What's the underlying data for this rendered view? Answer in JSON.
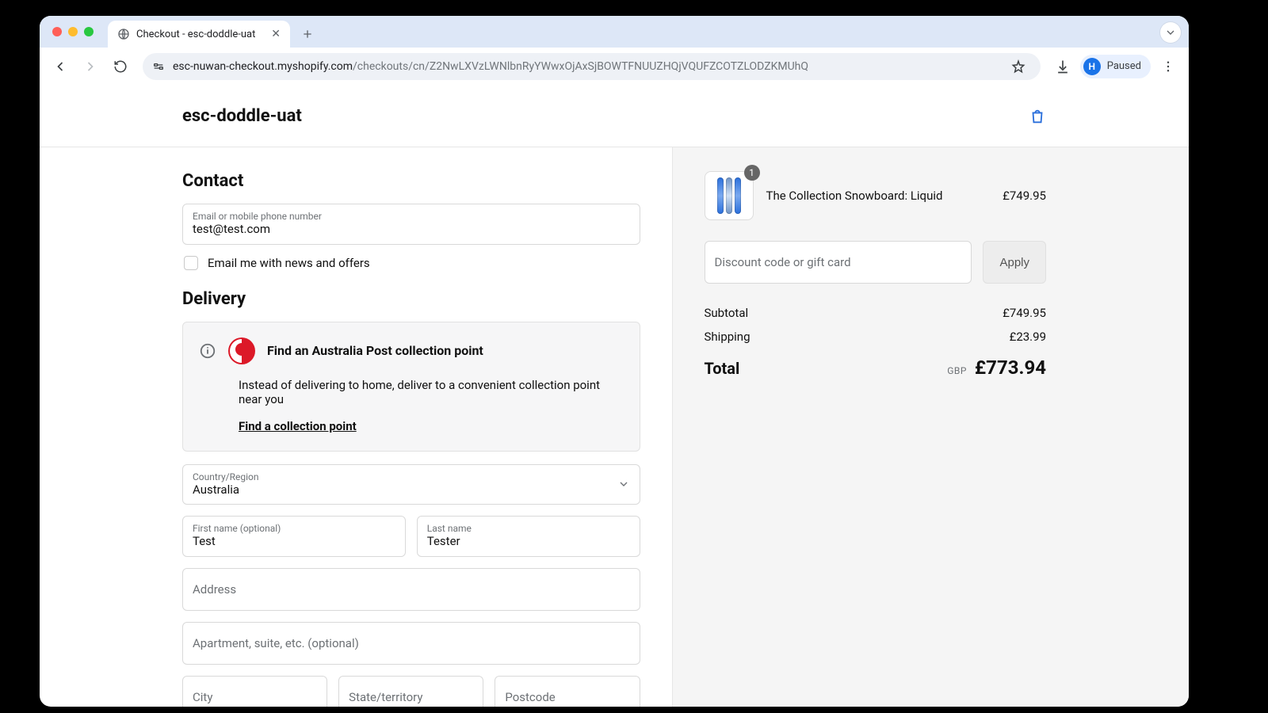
{
  "browser": {
    "tab_title": "Checkout - esc-doddle-uat",
    "url_host": "esc-nuwan-checkout.myshopify.com",
    "url_path": "/checkouts/cn/Z2NwLXVzLWNlbnRyYWwxOjAxSjBOWTFNUUZHQjVQUFZCOTZLODZKMUhQ",
    "profile_initial": "H",
    "profile_label": "Paused"
  },
  "header": {
    "store_name": "esc-doddle-uat"
  },
  "contact": {
    "heading": "Contact",
    "email_label": "Email or mobile phone number",
    "email_value": "test@test.com",
    "news_label": "Email me with news and offers"
  },
  "delivery": {
    "heading": "Delivery",
    "card_title": "Find an Australia Post collection point",
    "card_body": "Instead of delivering to home, deliver to a convenient collection point near you",
    "card_link": "Find a collection point",
    "country_label": "Country/Region",
    "country_value": "Australia",
    "first_name_label": "First name (optional)",
    "first_name_value": "Test",
    "last_name_label": "Last name",
    "last_name_value": "Tester",
    "address_ph": "Address",
    "apt_ph": "Apartment, suite, etc. (optional)",
    "city_ph": "City",
    "state_ph": "State/territory",
    "postcode_ph": "Postcode"
  },
  "summary": {
    "item": {
      "qty": "1",
      "name": "The Collection Snowboard: Liquid",
      "price": "£749.95"
    },
    "discount_ph": "Discount code or gift card",
    "apply_label": "Apply",
    "subtotal_label": "Subtotal",
    "subtotal_value": "£749.95",
    "shipping_label": "Shipping",
    "shipping_value": "£23.99",
    "total_label": "Total",
    "currency": "GBP",
    "total_value": "£773.94"
  }
}
